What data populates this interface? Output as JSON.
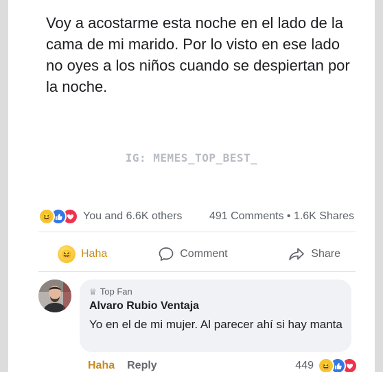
{
  "post": {
    "text": "Voy a acostarme esta noche en el lado de la cama de mi marido. Por lo visto en ese lado no oyes a los niños cuando se despiertan por la noche.",
    "watermark": "IG: MEMES_TOP_BEST_"
  },
  "reactions": {
    "summary": "You and 6.6K others",
    "comments_shares": "491 Comments • 1.6K Shares",
    "icons": [
      "haha-icon",
      "like-icon",
      "love-icon"
    ]
  },
  "actions": {
    "haha_label": "Haha",
    "comment_label": "Comment",
    "share_label": "Share"
  },
  "comment": {
    "badge": "Top Fan",
    "author": "Alvaro Rubio Ventaja",
    "text": "Yo en el de mi mujer. Al parecer ahí si hay manta",
    "haha_label": "Haha",
    "reply_label": "Reply",
    "reaction_count": "449"
  },
  "colors": {
    "haha_accent": "#c88a1d",
    "like_blue": "#3578e5",
    "love_red": "#f0334d",
    "bubble_bg": "#f0f2f5"
  }
}
